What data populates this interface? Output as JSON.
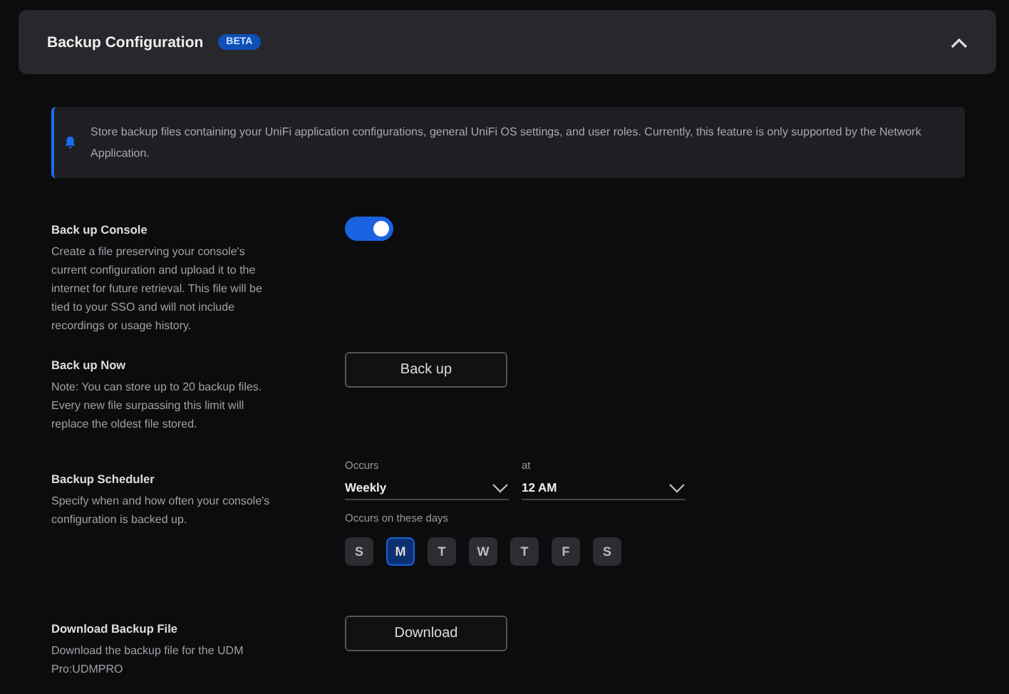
{
  "header": {
    "title": "Backup Configuration",
    "badge": "BETA",
    "expanded": true
  },
  "info": {
    "text": "Store backup files containing your UniFi application configurations, general UniFi OS settings, and user roles. Currently, this feature is only supported by the Network Application."
  },
  "sections": [
    {
      "kind": "toggle",
      "title": "Back up Console",
      "description": "Create a file preserving your console's current configuration and upload it to the internet for future retrieval. This file will be tied to your SSO and will not include recordings or usage history.",
      "on": true
    },
    {
      "kind": "button",
      "title": "Back up Now",
      "description": "Note: You can store up to 20 backup files. Every new file surpassing this limit will replace the oldest file stored.",
      "button": "Back up"
    },
    {
      "kind": "scheduler",
      "title": "Backup Scheduler",
      "description": "Specify when and how often your console's configuration is backed up.",
      "selects": [
        {
          "label": "Occurs",
          "value": "Weekly"
        },
        {
          "label": "at",
          "value": "12 AM"
        }
      ],
      "days_label": "Occurs on these days",
      "days": [
        {
          "label": "S",
          "selected": false
        },
        {
          "label": "M",
          "selected": true
        },
        {
          "label": "T",
          "selected": false
        },
        {
          "label": "W",
          "selected": false
        },
        {
          "label": "T",
          "selected": false
        },
        {
          "label": "F",
          "selected": false
        },
        {
          "label": "S",
          "selected": false
        }
      ]
    },
    {
      "kind": "button",
      "title": "Download Backup File",
      "description": "Download the backup file for the UDM Pro:UDMPRO",
      "button": "Download"
    }
  ]
}
